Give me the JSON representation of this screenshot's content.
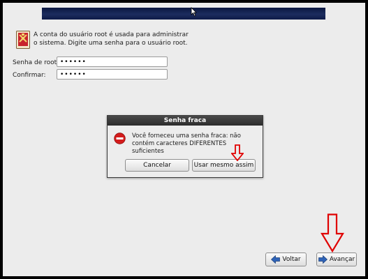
{
  "header": {
    "line1": "A conta do usuário root é usada para administrar",
    "line2": "o sistema. Digite uma senha para o usuário root."
  },
  "form": {
    "root_password_label": "Senha de root:",
    "root_password_value": "••••••",
    "confirm_label": "Confirmar:",
    "confirm_value": "••••••"
  },
  "dialog": {
    "title": "Senha fraca",
    "message_line1": "Você forneceu uma senha fraca: não",
    "message_line2": "contém caracteres DIFERENTES suficientes",
    "cancel_label": "Cancelar",
    "use_anyway_label": "Usar mesmo assim"
  },
  "navigation": {
    "back_label": "Voltar",
    "next_label": "Avançar"
  },
  "colors": {
    "annotation_arrow": "#e00000",
    "error_icon": "#d41c1c",
    "nav_arrow": "#2f64b8"
  },
  "icons": [
    "mouse-cursor-icon",
    "root-user-icon",
    "error-stop-icon",
    "back-arrow-icon",
    "next-arrow-icon",
    "annotation-down-arrow"
  ]
}
